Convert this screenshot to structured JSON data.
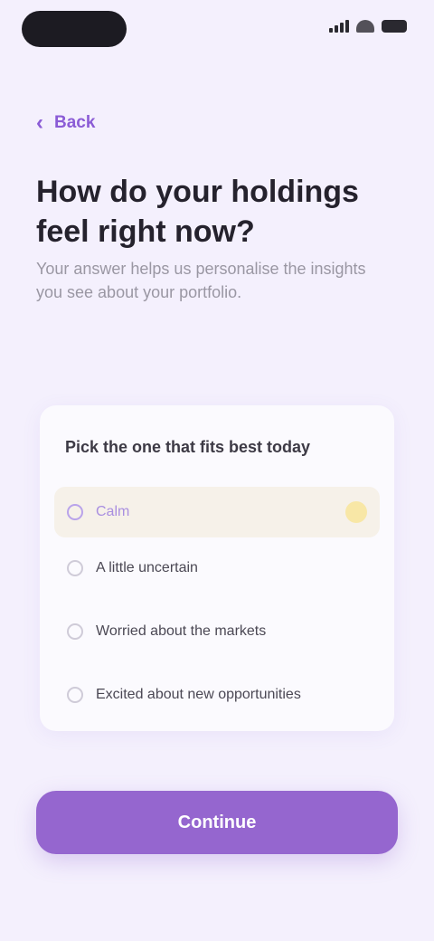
{
  "back": {
    "label": "Back",
    "icon": "chevron-left-icon"
  },
  "header": {
    "title": "How do your holdings feel right now?",
    "subtitle": "Your answer helps us personalise the insights you see about your portfolio."
  },
  "question": {
    "heading": "Pick the one that fits best today",
    "options": [
      {
        "label": "Calm",
        "selected": true
      },
      {
        "label": "A little uncertain",
        "selected": false
      },
      {
        "label": "Worried about the markets",
        "selected": false
      },
      {
        "label": "Excited about new opportunities",
        "selected": false
      }
    ]
  },
  "cta": {
    "label": "Continue"
  },
  "colors": {
    "accent": "#9566cf",
    "background": "#f4f0fd",
    "selected_bg": "#f6f1e9"
  }
}
